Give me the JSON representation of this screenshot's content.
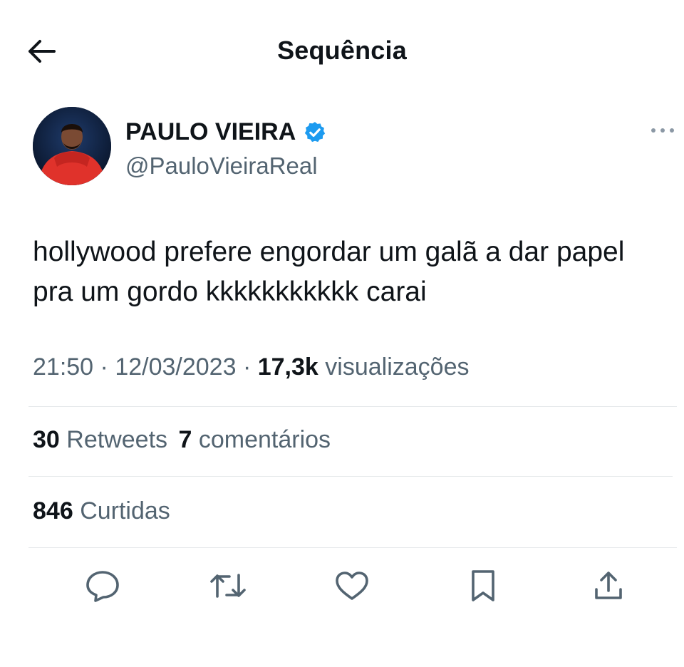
{
  "header": {
    "title": "Sequência",
    "back_icon": "arrow-left-icon"
  },
  "author": {
    "display_name": "PAULO VIEIRA",
    "handle": "@PauloVieiraReal",
    "verified": true,
    "verified_color": "#1d9bf0"
  },
  "tweet": {
    "text_line1": "hollywood prefere engordar um galã a dar papel",
    "text_line2": "pra um gordo kkkkkkkkkkk carai"
  },
  "meta": {
    "time": "21:50",
    "separator": "·",
    "date": "12/03/2023",
    "views_count": "17,3k",
    "views_label": "visualizações"
  },
  "stats": {
    "retweets_count": "30",
    "retweets_label": "Retweets",
    "comments_count": "7",
    "comments_label": "comentários",
    "likes_count": "846",
    "likes_label": "Curtidas"
  },
  "actions": [
    "reply-icon",
    "retweet-icon",
    "like-icon",
    "bookmark-icon",
    "share-icon"
  ],
  "colors": {
    "text": "#0f1419",
    "secondary": "#536471",
    "divider": "#e6e9eb",
    "accent": "#1d9bf0"
  }
}
